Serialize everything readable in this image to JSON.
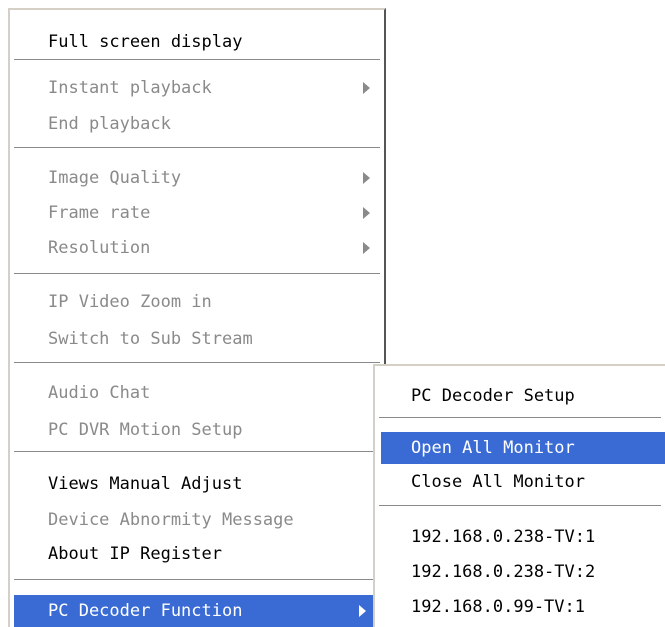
{
  "main_menu": {
    "items": [
      {
        "label": "Full screen display"
      },
      {
        "label": "Instant playback"
      },
      {
        "label": "End playback"
      },
      {
        "label": "Image Quality"
      },
      {
        "label": "Frame rate"
      },
      {
        "label": "Resolution"
      },
      {
        "label": "IP Video Zoom in"
      },
      {
        "label": "Switch to Sub Stream"
      },
      {
        "label": "Audio Chat"
      },
      {
        "label": "PC DVR Motion Setup"
      },
      {
        "label": "Views Manual Adjust"
      },
      {
        "label": "Device Abnormity Message"
      },
      {
        "label": "About IP Register"
      },
      {
        "label": "PC Decoder Function"
      }
    ]
  },
  "sub_menu": {
    "items": [
      {
        "label": "PC Decoder Setup"
      },
      {
        "label": "Open All Monitor"
      },
      {
        "label": "Close All Monitor"
      },
      {
        "label": "192.168.0.238-TV:1"
      },
      {
        "label": "192.168.0.238-TV:2"
      },
      {
        "label": "192.168.0.99-TV:1"
      }
    ]
  },
  "colors": {
    "highlight": "#3a6bd5",
    "disabled_text": "#8a8a8a"
  }
}
